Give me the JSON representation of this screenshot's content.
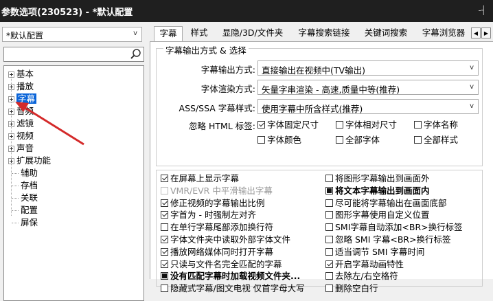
{
  "window": {
    "title": "参数选项(230523) - *默认配置",
    "pin_glyph": "-┤"
  },
  "left": {
    "preset": {
      "value": "*默认配置",
      "arrow": "v"
    },
    "search": {
      "value": "",
      "placeholder": ""
    },
    "tree": [
      {
        "label": "基本",
        "expandable": true
      },
      {
        "label": "播放",
        "expandable": true
      },
      {
        "label": "字幕",
        "expandable": true,
        "selected": true
      },
      {
        "label": "音频",
        "expandable": true
      },
      {
        "label": "滤镜",
        "expandable": true
      },
      {
        "label": "视频",
        "expandable": true
      },
      {
        "label": "声音",
        "expandable": true
      },
      {
        "label": "扩展功能",
        "expandable": true
      },
      {
        "label": "辅助",
        "expandable": false
      },
      {
        "label": "存档",
        "expandable": false
      },
      {
        "label": "关联",
        "expandable": false
      },
      {
        "label": "配置",
        "expandable": false
      },
      {
        "label": "屏保",
        "expandable": false
      }
    ]
  },
  "tabs": [
    "字幕",
    "样式",
    "显隐/3D/文件夹",
    "字幕搜索链接",
    "关键词搜索",
    "字幕浏览器"
  ],
  "tab_nav": {
    "prev": "◀",
    "next": "▶"
  },
  "output_group": {
    "legend": "字幕输出方式 & 选择",
    "output_mode": {
      "label": "字幕输出方式:",
      "value": "直接输出在视频中(TV输出)",
      "arrow": "v"
    },
    "font_render": {
      "label": "字体渲染方式:",
      "value": "矢量字串渲染 - 高速,质量中等(推荐)",
      "arrow": "v"
    },
    "ass_style": {
      "label": "ASS/SSA 字幕样式:",
      "value": "使用字幕中所含样式(推荐)",
      "arrow": "v"
    },
    "html_ignore": {
      "label": "忽略 HTML 标签:",
      "options": [
        {
          "label": "字体固定尺寸",
          "checked": true
        },
        {
          "label": "字体相对尺寸",
          "checked": false
        },
        {
          "label": "字体名称",
          "checked": false
        },
        {
          "label": "字体颜色",
          "checked": false
        },
        {
          "label": "全部字体",
          "checked": false
        },
        {
          "label": "全部样式",
          "checked": false
        }
      ]
    }
  },
  "options_left": [
    {
      "label": "在屏幕上显示字幕",
      "state": "checked"
    },
    {
      "label": "VMR/EVR 中平滑输出字幕",
      "state": "disabled"
    },
    {
      "label": "修正视频的字幕输出比例",
      "state": "checked"
    },
    {
      "label": "字首为 - 时强制左对齐",
      "state": "checked"
    },
    {
      "label": "在单行字幕尾部添加换行符",
      "state": "unchecked"
    },
    {
      "label": "字体文件夹中读取外部字体文件",
      "state": "checked"
    },
    {
      "label": "播放网络媒体同时打开字幕",
      "state": "checked"
    },
    {
      "label": "只读与文件名完全匹配的字幕",
      "state": "checked"
    },
    {
      "label": "没有匹配字幕时加载视频文件夹...",
      "state": "filled"
    },
    {
      "label": "隐藏式字幕/图文电视 仅首字母大写",
      "state": "unchecked"
    }
  ],
  "options_right": [
    {
      "label": "将图形字幕输出到画面外",
      "state": "unchecked"
    },
    {
      "label": "将文本字幕输出到画面内",
      "state": "filled"
    },
    {
      "label": "尽可能将字幕输出在画面底部",
      "state": "unchecked"
    },
    {
      "label": "图形字幕使用自定义位置",
      "state": "unchecked"
    },
    {
      "label": "SMI字幕自动添加<BR>换行标签",
      "state": "unchecked"
    },
    {
      "label": "忽略 SMI 字幕<BR>换行标签",
      "state": "unchecked"
    },
    {
      "label": "适当调节 SMI 字幕时间",
      "state": "unchecked"
    },
    {
      "label": "开启字幕动画特性",
      "state": "checked"
    },
    {
      "label": "去除左/右空格符",
      "state": "unchecked"
    },
    {
      "label": "删除空白行",
      "state": "unchecked"
    }
  ],
  "colors": {
    "selection": "#0a64d8",
    "titlebar": "#1f1f1f",
    "annotation_arrow": "#d42a2a"
  }
}
